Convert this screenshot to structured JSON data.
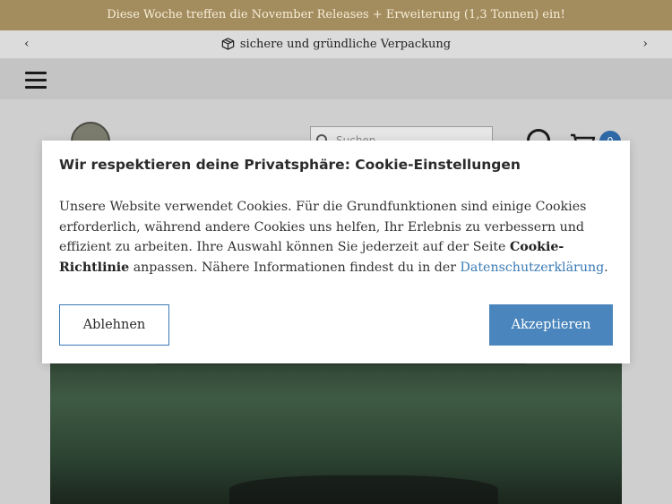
{
  "announcement": {
    "text": "Diese Woche treffen die November Releases + Erweiterung (1,3 Tonnen) ein!"
  },
  "usp_bar": {
    "text": "sichere und gründliche Verpackung",
    "icon": "box-icon",
    "prev_glyph": "‹",
    "next_glyph": "›"
  },
  "header": {
    "search_placeholder": "Suchen",
    "cart_count": "0"
  },
  "cookie_dialog": {
    "title": "Wir respektieren deine Privatsphäre: Cookie-Einstellungen",
    "body_part1": "Unsere Website verwendet Cookies. Für die Grundfunktionen sind einige Cookies erforderlich, während andere Cookies uns helfen, Ihr Erlebnis zu verbessern und effizient zu arbeiten. Ihre Auswahl können Sie jederzeit auf der Seite ",
    "body_bold": "Cookie-Richtlinie",
    "body_part2": " anpassen. Nähere Informationen findest du in der ",
    "privacy_link": "Datenschutzerklärung",
    "body_end": ".",
    "decline_label": "Ablehnen",
    "accept_label": "Akzeptieren"
  },
  "colors": {
    "announcement_bg": "#a38c5e",
    "accent_blue": "#4a86bd",
    "link_blue": "#3a7ab5"
  }
}
